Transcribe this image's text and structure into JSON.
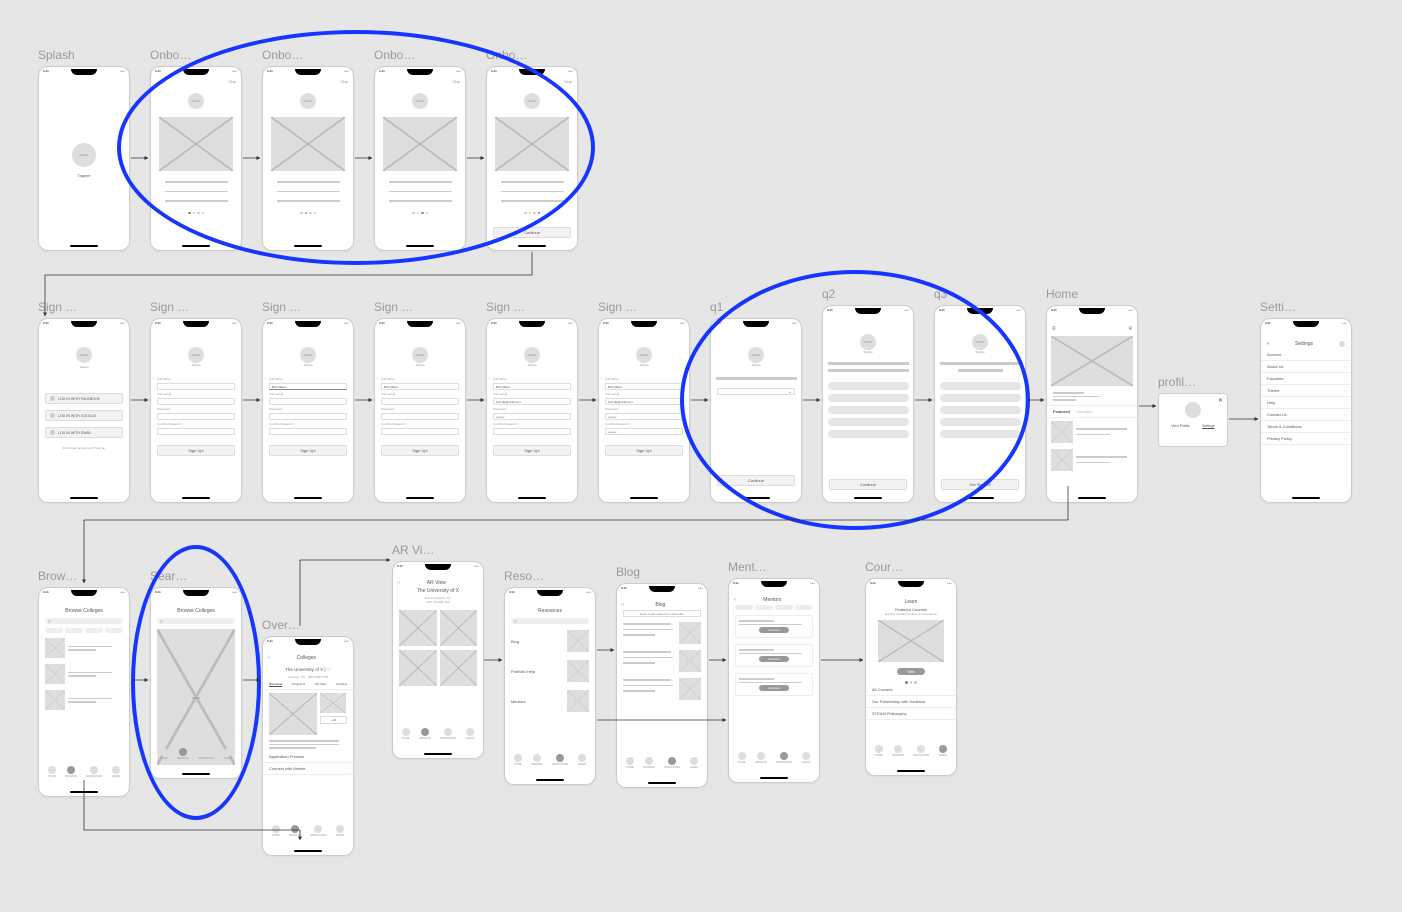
{
  "global": {
    "time": "9:41",
    "logo_text": "LOGO",
    "tagline": "Tagline",
    "skip": "Skip",
    "continue": "Continue",
    "signup": "Sign Up!",
    "get_started": "Get Started!"
  },
  "labels": {
    "splash": "Splash",
    "onbo": "Onbo…",
    "sign": "Sign …",
    "q1": "q1",
    "q2": "q2",
    "q3": "q3",
    "home": "Home",
    "profile": "profil…",
    "settings": "Setti…",
    "browse": "Brow…",
    "search": "Sear…",
    "overview": "Over…",
    "ar": "AR Vi…",
    "resources": "Reso…",
    "blog": "Blog",
    "mentors": "Ment…",
    "courses": "Cour…"
  },
  "signin1": {
    "facebook": "LOG IN WITH FACEBOOK",
    "google": "LOG IN WITH GOOGLE",
    "email": "LOG IN WITH EMAIL",
    "footer": "Don't have an account? Sign up"
  },
  "signup_fields": {
    "fullname_lbl": "Full Name",
    "fullname_val": "Bob Aitken",
    "email_lbl": "Your email",
    "email_val": "bob.aik@mail.com",
    "password_lbl": "Password",
    "password_val": "••••••••",
    "confirm_lbl": "Confirm Password"
  },
  "home": {
    "featured": "Featured",
    "favorites": "Favorites"
  },
  "profile_popup": {
    "view": "View Profile",
    "settings": "Settings"
  },
  "settings": {
    "title": "Settings",
    "items": [
      "Account",
      "About Us",
      "Favorites",
      "Theme",
      "Help",
      "Contact Us",
      "Terms & Conditions",
      "Privacy Policy"
    ]
  },
  "browse": {
    "title": "Browse Colleges",
    "map": "map"
  },
  "overview": {
    "title": "Colleges",
    "uni": "The University of X | ♡",
    "sub": "Anytown, NY · (555) 888-7755",
    "tabs": [
      "Overview",
      "Programs",
      "AR View",
      "Funding"
    ],
    "app": "Application Process",
    "mentor": "Connect with Mentor"
  },
  "ar": {
    "title": "AR View",
    "uni": "The University of X",
    "l1": "Enroll: Anytown, NY",
    "l2": "Size: 20,000 total"
  },
  "resources": {
    "title": "Resources",
    "blog": "Blog",
    "portfolio": "Portfolio Help",
    "mentors": "Mentors"
  },
  "blog": {
    "title": "Blog",
    "subscribe": "Enter email address to subscribe"
  },
  "mentors": {
    "title": "Mentors",
    "connect": "Connect"
  },
  "courses": {
    "title": "Learn",
    "featured": "Featured Courses",
    "sub": "Explore trending content from Kadenze",
    "view": "View",
    "r1": "All Courses",
    "r2": "Our Partnership with Kadenze",
    "r3": "STEAM Philosophy"
  },
  "tabnav": {
    "home": "HOME",
    "browse": "BROWSE",
    "resources": "RESOURCES",
    "learn": "LEARN"
  }
}
